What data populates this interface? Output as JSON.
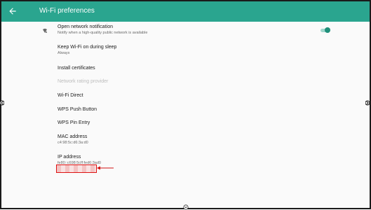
{
  "header": {
    "title": "Wi-Fi preferences"
  },
  "items": [
    {
      "title": "Open network notification",
      "subtitle": "Notify when a high-quality public network is available",
      "icon": "notification-wifi-icon",
      "toggle": {
        "on": true,
        "color": "#1f8f7a"
      }
    },
    {
      "title": "Keep Wi-Fi on during sleep",
      "subtitle": "Always"
    },
    {
      "title": "Install certificates",
      "subtitle": ""
    },
    {
      "title": "Network rating provider",
      "subtitle": "",
      "disabled": true
    },
    {
      "title": "Wi-Fi Direct",
      "subtitle": ""
    },
    {
      "title": "WPS Push Button",
      "subtitle": ""
    },
    {
      "title": "WPS Pin Entry",
      "subtitle": ""
    },
    {
      "title": "MAC address",
      "subtitle": "c4:98:5c:d6:3a:d0"
    },
    {
      "title": "IP address",
      "subtitle": "fe80::c698:5cff:fed6:3ad0"
    }
  ],
  "colors": {
    "appbar": "#2aa58f",
    "redaction_border": "#d11111"
  }
}
